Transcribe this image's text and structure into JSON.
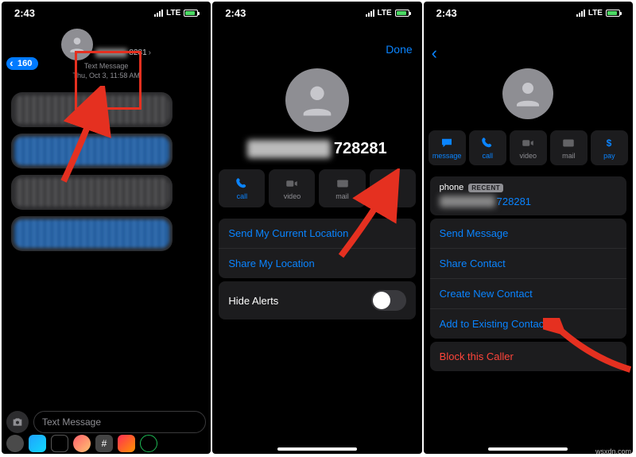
{
  "status": {
    "time": "2:43",
    "carrier": "LTE"
  },
  "screen1": {
    "back_count": "160",
    "contact_suffix": "8281",
    "msg_type": "Text Message",
    "timestamp": "Thu, Oct 3, 11:58 AM",
    "input_placeholder": "Text Message"
  },
  "screen2": {
    "done": "Done",
    "name_suffix": "728281",
    "actions": {
      "call": "call",
      "video": "video",
      "mail": "mail",
      "info": "info"
    },
    "send_location": "Send My Current Location",
    "share_location": "Share My Location",
    "hide_alerts": "Hide Alerts"
  },
  "screen3": {
    "actions": {
      "message": "message",
      "call": "call",
      "video": "video",
      "mail": "mail",
      "pay": "pay"
    },
    "phone_label": "phone",
    "recent_badge": "RECENT",
    "phone_suffix": "728281",
    "rows": {
      "send_message": "Send Message",
      "share_contact": "Share Contact",
      "create_contact": "Create New Contact",
      "add_existing": "Add to Existing Contact",
      "block": "Block this Caller"
    }
  },
  "watermark": "wsxdn.com"
}
